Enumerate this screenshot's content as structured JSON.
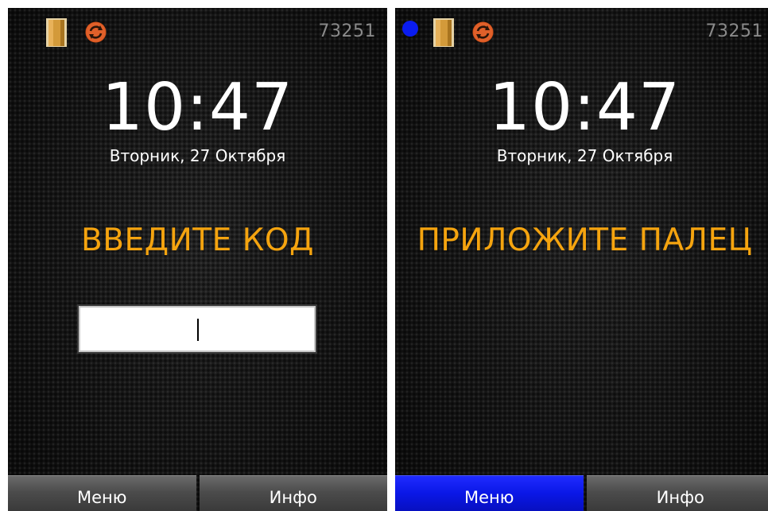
{
  "screens": [
    {
      "device_id": "73251",
      "time": "10:47",
      "date": "Вторник, 27 Октября",
      "prompt": "ВВЕДИТЕ КОД",
      "code_value": "",
      "softkeys": {
        "menu": "Меню",
        "info": "Инфо"
      },
      "active_softkey": "none"
    },
    {
      "device_id": "73251",
      "time": "10:47",
      "date": "Вторник, 27 Октября",
      "prompt": "ПРИЛОЖИТЕ ПАЛЕЦ",
      "softkeys": {
        "menu": "Меню",
        "info": "Инфо"
      },
      "active_softkey": "menu",
      "indicator": "blue-dot"
    }
  ],
  "colors": {
    "prompt": "#f5a40f",
    "indicator": "#0a1cf0",
    "softkey_active": "#0a17e6",
    "softkey_normal": "#4c4c4c"
  },
  "icons": [
    "door-icon",
    "sync-icon"
  ]
}
